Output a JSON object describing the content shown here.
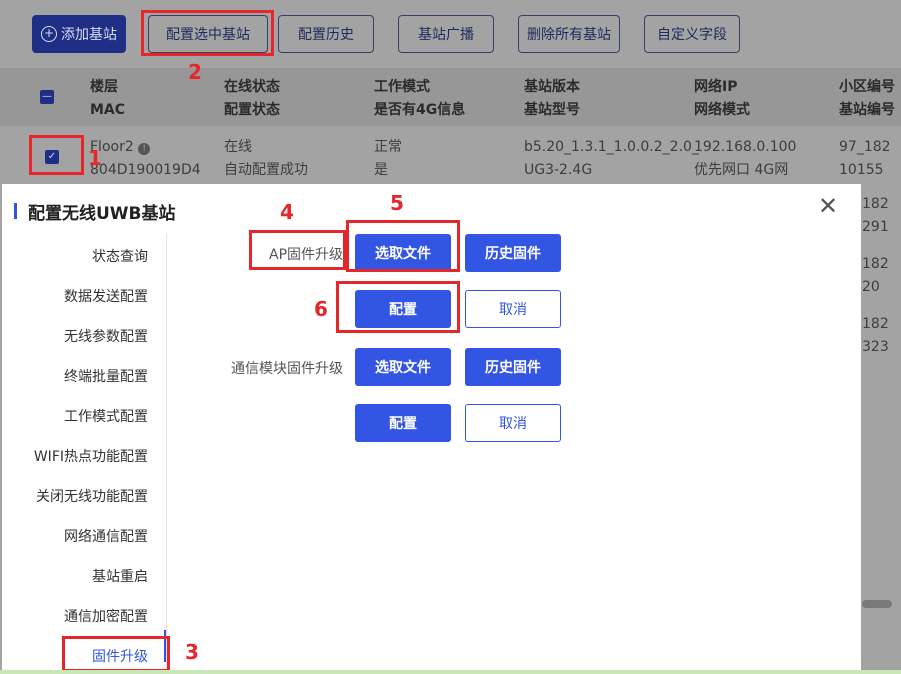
{
  "toolbar": {
    "add_label": "添加基站",
    "config_selected_label": "配置选中基站",
    "config_history_label": "配置历史",
    "broadcast_label": "基站广播",
    "delete_all_label": "删除所有基站",
    "custom_field_label": "自定义字段"
  },
  "table": {
    "headers": [
      {
        "top": "楼层",
        "bottom": "MAC"
      },
      {
        "top": "在线状态",
        "bottom": "配置状态"
      },
      {
        "top": "工作模式",
        "bottom": "是否有4G信息"
      },
      {
        "top": "基站版本",
        "bottom": "基站型号"
      },
      {
        "top": "网络IP",
        "bottom": "网络模式"
      },
      {
        "top": "小区编号",
        "bottom": "基站编号"
      }
    ],
    "row": {
      "floor": "Floor2",
      "mac": "804D190019D4",
      "online": "在线",
      "config": "自动配置成功",
      "mode": "正常",
      "has4g": "是",
      "version": "b5.20_1.3.1_1.0.0.2_2.0_",
      "model": "UG3-2.4G",
      "ip": "192.168.0.100",
      "netmode": "优先网口 4G网",
      "cell": "97_182",
      "station": "10155"
    },
    "partial_rows": [
      "182",
      "291",
      "182",
      "20",
      "182",
      "323"
    ]
  },
  "modal": {
    "title": "配置无线UWB基站",
    "sidebar": [
      "状态查询",
      "数据发送配置",
      "无线参数配置",
      "终端批量配置",
      "工作模式配置",
      "WIFI热点功能配置",
      "关闭无线功能配置",
      "网络通信配置",
      "基站重启",
      "通信加密配置",
      "固件升级"
    ],
    "ap_label": "AP固件升级",
    "comm_label": "通信模块固件升级",
    "select_file": "选取文件",
    "history_firmware": "历史固件",
    "configure": "配置",
    "cancel": "取消"
  },
  "annotations": [
    "1",
    "2",
    "3",
    "4",
    "5",
    "6"
  ],
  "colors": {
    "accent": "#3355e4",
    "annotation": "#e5262b"
  }
}
